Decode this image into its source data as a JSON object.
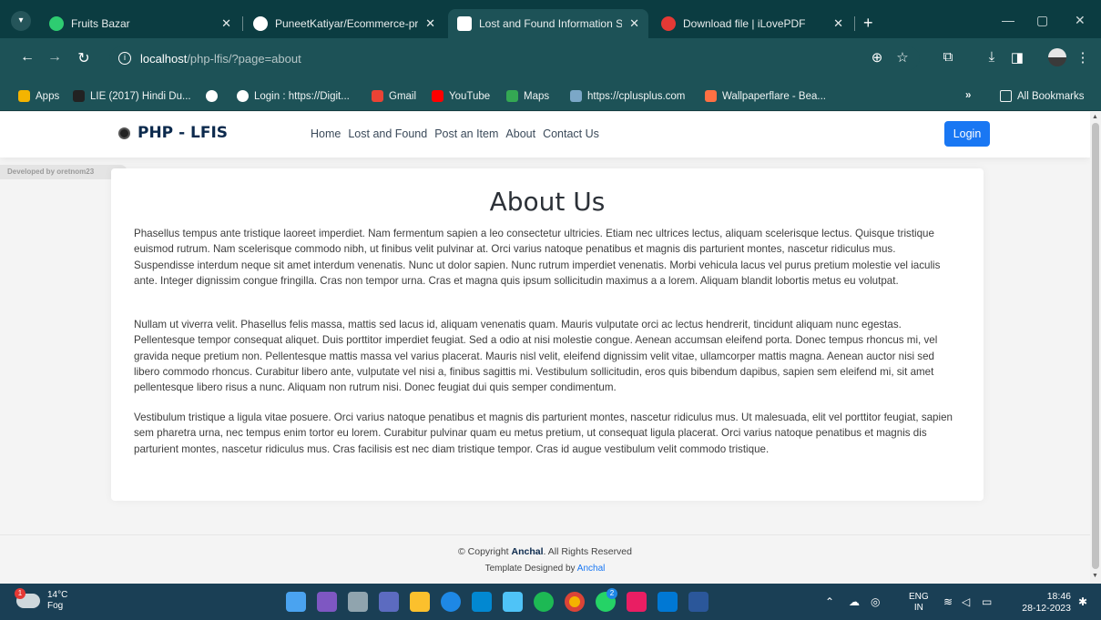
{
  "browser": {
    "tabs": [
      {
        "title": "Fruits Bazar",
        "favicon_color": "#2ecc71"
      },
      {
        "title": "PuneetKatiyar/Ecommerce-proj",
        "favicon_color": "#ffffff"
      },
      {
        "title": "Lost and Found Information Sy",
        "favicon_color": "#ffffff"
      },
      {
        "title": "Download file | iLovePDF",
        "favicon_color": "#e53935"
      }
    ],
    "url_host": "localhost",
    "url_path": "/php-lfis/?page=about",
    "bookmarks": [
      "Apps",
      "LIE (2017) Hindi Du...",
      "Login : https://Digit...",
      "Gmail",
      "YouTube",
      "Maps",
      "https://cplusplus.com",
      "Wallpaperflare - Bea..."
    ],
    "all_bookmarks": "All Bookmarks"
  },
  "site": {
    "logo_text": "PHP - LFIS",
    "nav": [
      "Home",
      "Lost and Found",
      "Post an Item",
      "About",
      "Contact Us"
    ],
    "login_label": "Login",
    "dev_tag": "Developed by oretnom23"
  },
  "about": {
    "title": "About Us",
    "paragraphs": [
      "Phasellus tempus ante tristique laoreet imperdiet. Nam fermentum sapien a leo consectetur ultricies. Etiam nec ultrices lectus, aliquam scelerisque lectus. Quisque tristique euismod rutrum. Nam scelerisque commodo nibh, ut finibus velit pulvinar at. Orci varius natoque penatibus et magnis dis parturient montes, nascetur ridiculus mus. Suspendisse interdum neque sit amet interdum venenatis. Nunc ut dolor sapien. Nunc rutrum imperdiet venenatis. Morbi vehicula lacus vel purus pretium molestie vel iaculis ante. Integer dignissim congue fringilla. Cras non tempor urna. Cras et magna quis ipsum sollicitudin maximus a a lorem. Aliquam blandit lobortis metus eu volutpat.",
      "Nullam ut viverra velit. Phasellus felis massa, mattis sed lacus id, aliquam venenatis quam. Mauris vulputate orci ac lectus hendrerit, tincidunt aliquam nunc egestas. Pellentesque tempor consequat aliquet. Duis porttitor imperdiet feugiat. Sed a odio at nisi molestie congue. Aenean accumsan eleifend porta. Donec tempus rhoncus mi, vel gravida neque pretium non. Pellentesque mattis massa vel varius placerat. Mauris nisl velit, eleifend dignissim velit vitae, ullamcorper mattis magna. Aenean auctor nisi sed libero commodo rhoncus. Curabitur libero ante, vulputate vel nisi a, finibus sagittis mi. Vestibulum sollicitudin, eros quis bibendum dapibus, sapien sem eleifend mi, sit amet pellentesque libero risus a nunc. Aliquam non rutrum nisi. Donec feugiat dui quis semper condimentum.",
      "Vestibulum tristique a ligula vitae posuere. Orci varius natoque penatibus et magnis dis parturient montes, nascetur ridiculus mus. Ut malesuada, elit vel porttitor feugiat, sapien sem pharetra urna, nec tempus enim tortor eu lorem. Curabitur pulvinar quam eu metus pretium, ut consequat ligula placerat. Orci varius natoque penatibus et magnis dis parturient montes, nascetur ridiculus mus. Cras facilisis est nec diam tristique tempor. Cras id augue vestibulum velit commodo tristique."
    ]
  },
  "footer": {
    "copyright_prefix": "© Copyright",
    "copyright_name": "Anchal",
    "copyright_suffix": ". All Rights Reserved",
    "credit_prefix": "Template Designed by",
    "credit_name": "Anchal"
  },
  "taskbar": {
    "weather_temp": "14°C",
    "weather_desc": "Fog",
    "weather_badge": "1",
    "chrome_badge": "2",
    "lang_1": "ENG",
    "lang_2": "IN",
    "time": "18:46",
    "date": "28-12-2023"
  },
  "colors": {
    "browser_frame": "#1d5257",
    "login_button": "#1977f3",
    "brand_text": "#0c2a4d"
  }
}
